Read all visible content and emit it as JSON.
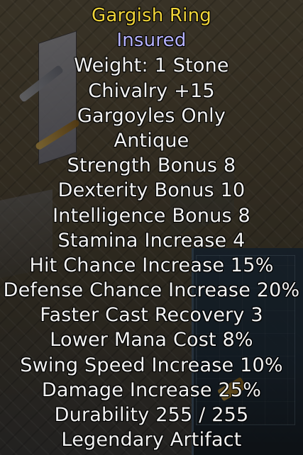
{
  "item": {
    "name": "Gargish Ring",
    "status": "Insured",
    "properties": [
      "Weight: 1 Stone",
      "Chivalry +15",
      "Gargoyles Only",
      "Antique",
      "Strength Bonus 8",
      "Dexterity Bonus 10",
      "Intelligence Bonus 8",
      "Stamina Increase 4",
      "Hit Chance Increase 15%",
      "Defense Chance Increase 20%",
      "Faster Cast Recovery 3",
      "Lower Mana Cost 8%",
      "Swing Speed Increase 10%",
      "Damage Increase 25%",
      "Durability 255 / 255",
      "Legendary Artifact"
    ]
  },
  "colors": {
    "title": "#f0d53a",
    "status": "#b6b3ff",
    "text": "#f2f2f2",
    "tooltip_bg": "#0c0c0a"
  },
  "icons": [
    "sword-icon",
    "weapon-icon"
  ]
}
